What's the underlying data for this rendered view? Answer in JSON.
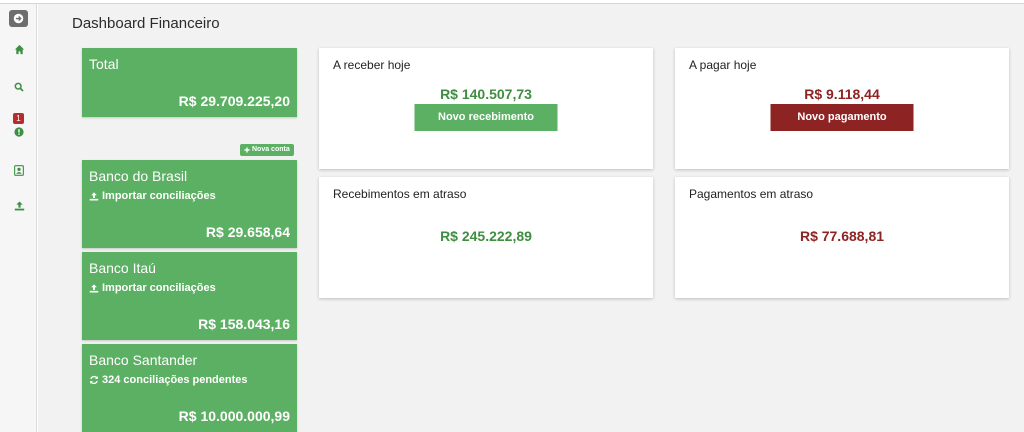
{
  "page": {
    "title": "Dashboard Financeiro"
  },
  "sidebar": {
    "toggle_icon": "arrow-right-circle-icon",
    "items": [
      {
        "icon": "home-icon"
      },
      {
        "icon": "search-icon"
      },
      {
        "icon": "alert-circle-icon",
        "badge": "1"
      },
      {
        "icon": "contact-card-icon"
      },
      {
        "icon": "upload-icon"
      }
    ]
  },
  "total": {
    "label": "Total",
    "amount": "R$ 29.709.225,20"
  },
  "new_account_button": {
    "label": "Nova conta",
    "icon": "plus-icon"
  },
  "accounts": [
    {
      "name": "Banco do Brasil",
      "action": "Importar conciliações",
      "action_icon": "upload-icon",
      "amount": "R$ 29.658,64"
    },
    {
      "name": "Banco Itaú",
      "action": "Importar conciliações",
      "action_icon": "upload-icon",
      "amount": "R$ 158.043,16"
    },
    {
      "name": "Banco Santander",
      "action": "324 conciliações pendentes",
      "action_icon": "refresh-icon",
      "amount": "R$ 10.000.000,99"
    }
  ],
  "receive_today": {
    "title": "A receber hoje",
    "amount": "R$ 140.507,73",
    "button": "Novo recebimento"
  },
  "pay_today": {
    "title": "A pagar hoje",
    "amount": "R$ 9.118,44",
    "button": "Novo pagamento"
  },
  "overdue_receipts": {
    "title": "Recebimentos em atraso",
    "amount": "R$ 245.222,89"
  },
  "overdue_payments": {
    "title": "Pagamentos em atraso",
    "amount": "R$ 77.688,81"
  },
  "colors": {
    "green": "#5cb063",
    "dark_green_text": "#3f8e3f",
    "dark_red": "#8d2323",
    "red_badge": "#b52d2d"
  }
}
